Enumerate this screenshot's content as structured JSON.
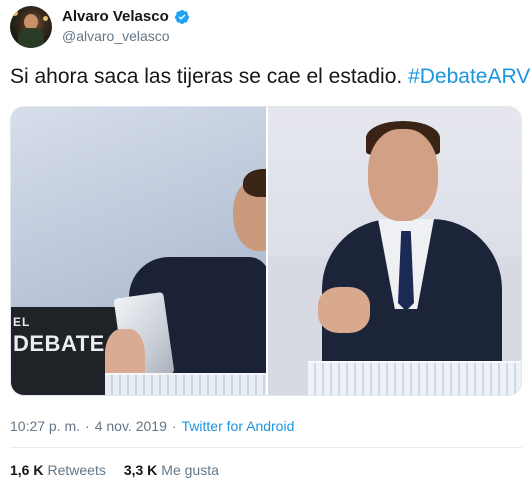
{
  "author": {
    "display_name": "Alvaro Velasco",
    "handle": "@alvaro_velasco",
    "verified": true,
    "verified_icon": "verified-badge-icon"
  },
  "tweet": {
    "text": "Si ahora saca las tijeras se cae el estadio.",
    "hashtag": "#DebateARV"
  },
  "media": {
    "logo_top": "EL",
    "logo_main": "DEBATE"
  },
  "meta": {
    "time": "10:27 p. m.",
    "separator": "·",
    "date": "4 nov. 2019",
    "source": "Twitter for Android"
  },
  "stats": {
    "retweets_count": "1,6 K",
    "retweets_label": "Retweets",
    "likes_count": "3,3 K",
    "likes_label": "Me gusta"
  },
  "colors": {
    "accent": "#1b95e0",
    "text": "#14171a",
    "muted": "#657786"
  }
}
